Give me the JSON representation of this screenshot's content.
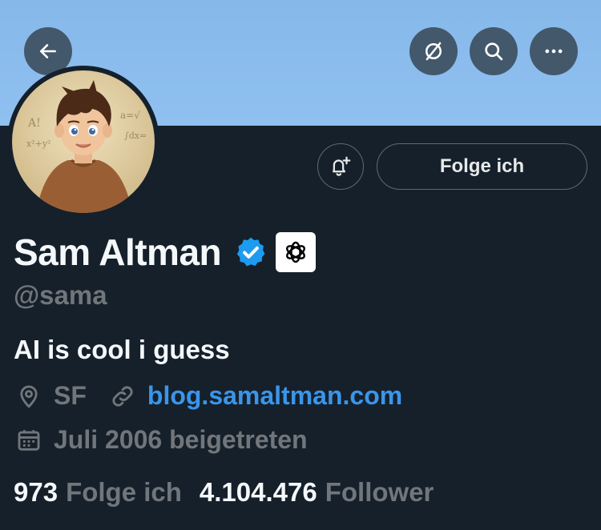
{
  "top_bar": {
    "back_icon": "arrow-left-icon",
    "mute_icon": "circle-slash-icon",
    "search_icon": "search-icon",
    "more_icon": "more-horizontal-icon"
  },
  "profile": {
    "avatar_icon": "profile-avatar",
    "notify_icon": "bell-plus-icon",
    "follow_label": "Folge ich",
    "name": "Sam Altman",
    "verified_icon": "verified-badge-icon",
    "affiliate_icon": "openai-logo-icon",
    "handle": "@sama",
    "bio": "AI is cool i guess",
    "location": "SF",
    "website": "blog.samaltman.com",
    "joined": "Juli 2006 beigetreten",
    "following_count": "973",
    "following_label": "Folge ich",
    "followers_count": "4.104.476",
    "followers_label": "Follower"
  },
  "colors": {
    "background": "#15202b",
    "banner": "#8fc0f0",
    "link": "#3b95e8",
    "muted": "#71767b",
    "verified": "#1d9bf0"
  }
}
